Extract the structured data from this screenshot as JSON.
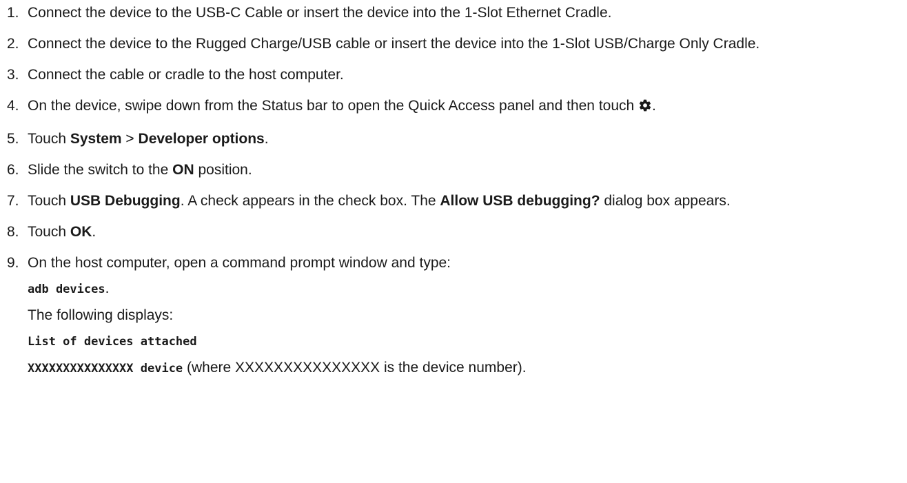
{
  "steps": [
    {
      "num": "1.",
      "text": "Connect the device to the USB-C Cable or insert the device into the 1-Slot Ethernet Cradle."
    },
    {
      "num": "2.",
      "text": "Connect the device to the Rugged Charge/USB cable or insert the device into the 1-Slot USB/Charge Only Cradle."
    },
    {
      "num": "3.",
      "text": "Connect the cable or cradle to the host computer."
    },
    {
      "num": "4.",
      "text_before": "On the device, swipe down from the Status bar to open the Quick Access panel and then touch ",
      "icon": "gear-icon",
      "text_after": "."
    },
    {
      "num": "5.",
      "pre": "Touch ",
      "bold1": "System",
      "mid": " > ",
      "bold2": "Developer options",
      "post": "."
    },
    {
      "num": "6.",
      "pre": "Slide the switch to the ",
      "bold": "ON",
      "post": " position."
    },
    {
      "num": "7.",
      "pre": "Touch ",
      "bold1": "USB Debugging",
      "mid": ". A check appears in the check box. The ",
      "bold2": "Allow USB debugging?",
      "post": " dialog box appears."
    },
    {
      "num": "8.",
      "pre": "Touch ",
      "bold": "OK",
      "post": "."
    },
    {
      "num": "9.",
      "text": "On the host computer, open a command prompt window and type:",
      "cmd": "adb devices",
      "cmd_post": ".",
      "displays": "The following displays:",
      "output1": "List of devices attached",
      "output2_code": "XXXXXXXXXXXXXXX device",
      "output2_text": " (where XXXXXXXXXXXXXXX is the device number)."
    }
  ]
}
